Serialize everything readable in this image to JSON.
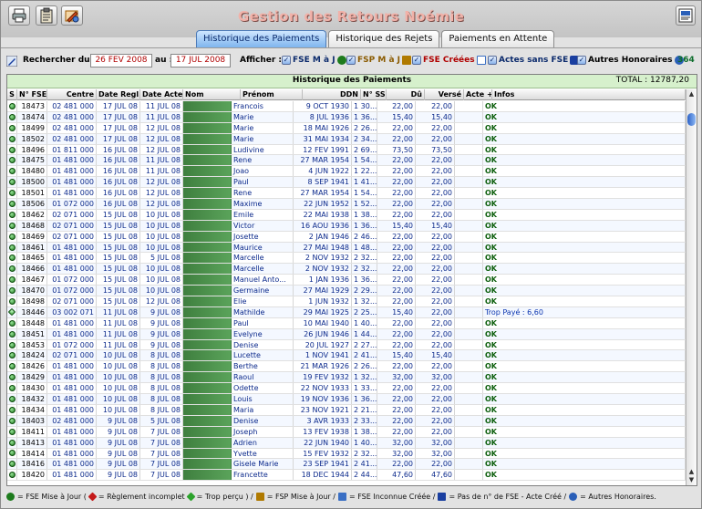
{
  "window": {
    "title": "Gestion des Retours Noémie"
  },
  "toolbar": {
    "print_icon": "printer-icon",
    "clipboard_icon": "clipboard-icon",
    "tools_icon": "pencil-gear-icon",
    "help_icon": "help-icon"
  },
  "tabs": [
    {
      "label": "Historique des Paiements",
      "active": true
    },
    {
      "label": "Historique des Rejets",
      "active": false
    },
    {
      "label": "Paiements en Attente",
      "active": false
    }
  ],
  "filters": {
    "search_label": "Rechercher du :",
    "date_from": "26 FEV 2008",
    "to_label": "au :",
    "date_to": "17 JUL 2008",
    "show_label": "Afficher :",
    "options": [
      {
        "label": "FSE M à J",
        "checked": true,
        "color": "#0b2a6c"
      },
      {
        "label": "FSP M à J",
        "checked": true,
        "color": "#8a5a00"
      },
      {
        "label": "FSE Créées",
        "checked": true,
        "color": "#b00000"
      },
      {
        "label": "Actes sans FSE",
        "checked": true,
        "color": "#0b2a6c"
      },
      {
        "label": "Autres Honoraires",
        "checked": true,
        "color": "#000000"
      }
    ],
    "count": "364"
  },
  "panel": {
    "title": "Historique des Paiements",
    "total": "TOTAL : 12787,20"
  },
  "columns": [
    "S",
    "N° FSE",
    "Centre",
    "Date Regl.",
    "Date Acte",
    "Nom",
    "Prénom",
    "DDN",
    "N° SS",
    "Dû",
    "Versé",
    "Acte +",
    "Infos"
  ],
  "rows": [
    {
      "s": "ok",
      "fse": "18473",
      "centre": "02 481 000",
      "regl": "17 JUL 08",
      "acte": "11 JUL 08",
      "nom": "G",
      "prenom": "Francois",
      "ddn": "9 OCT 1930",
      "ss": "1 30...",
      "du": "22,00",
      "verse": "22,00",
      "plus": "",
      "info": "OK"
    },
    {
      "s": "ok",
      "fse": "18474",
      "centre": "02 481 000",
      "regl": "17 JUL 08",
      "acte": "11 JUL 08",
      "nom": "G",
      "prenom": "Marie",
      "ddn": "8 JUL 1936",
      "ss": "1 36...",
      "du": "15,40",
      "verse": "15,40",
      "plus": "",
      "info": "OK"
    },
    {
      "s": "ok",
      "fse": "18499",
      "centre": "02 481 000",
      "regl": "17 JUL 08",
      "acte": "12 JUL 08",
      "nom": "B",
      "prenom": "Marie",
      "ddn": "18 MAI 1926",
      "ss": "2 26...",
      "du": "22,00",
      "verse": "22,00",
      "plus": "",
      "info": "OK"
    },
    {
      "s": "ok",
      "fse": "18502",
      "centre": "02 481 000",
      "regl": "17 JUL 08",
      "acte": "12 JUL 08",
      "nom": "P",
      "prenom": "Marie",
      "ddn": "31 MAI 1934",
      "ss": "2 34...",
      "du": "22,00",
      "verse": "22,00",
      "plus": "",
      "info": "OK"
    },
    {
      "s": "ok",
      "fse": "18496",
      "centre": "01 811 000",
      "regl": "16 JUL 08",
      "acte": "12 JUL 08",
      "nom": "C",
      "prenom": "Ludivine",
      "ddn": "12 FEV 1991",
      "ss": "2 69...",
      "du": "73,50",
      "verse": "73,50",
      "plus": "",
      "info": "OK"
    },
    {
      "s": "ok",
      "fse": "18475",
      "centre": "01 481 000",
      "regl": "16 JUL 08",
      "acte": "11 JUL 08",
      "nom": "A",
      "prenom": "Rene",
      "ddn": "27 MAR 1954",
      "ss": "1 54...",
      "du": "22,00",
      "verse": "22,00",
      "plus": "",
      "info": "OK"
    },
    {
      "s": "ok",
      "fse": "18480",
      "centre": "01 481 000",
      "regl": "16 JUL 08",
      "acte": "11 JUL 08",
      "nom": "D",
      "prenom": "Joao",
      "ddn": "4 JUN 1922",
      "ss": "1 22...",
      "du": "22,00",
      "verse": "22,00",
      "plus": "",
      "info": "OK"
    },
    {
      "s": "ok",
      "fse": "18500",
      "centre": "01 481 000",
      "regl": "16 JUL 08",
      "acte": "12 JUL 08",
      "nom": "M",
      "prenom": "Paul",
      "ddn": "8 SEP 1941",
      "ss": "1 41...",
      "du": "22,00",
      "verse": "22,00",
      "plus": "",
      "info": "OK"
    },
    {
      "s": "ok",
      "fse": "18501",
      "centre": "01 481 000",
      "regl": "16 JUL 08",
      "acte": "12 JUL 08",
      "nom": "A",
      "prenom": "Rene",
      "ddn": "27 MAR 1954",
      "ss": "1 54...",
      "du": "22,00",
      "verse": "22,00",
      "plus": "",
      "info": "OK"
    },
    {
      "s": "ok",
      "fse": "18506",
      "centre": "01 072 000",
      "regl": "16 JUL 08",
      "acte": "12 JUL 08",
      "nom": "D",
      "prenom": "Maxime",
      "ddn": "22 JUN 1952",
      "ss": "1 52...",
      "du": "22,00",
      "verse": "22,00",
      "plus": "",
      "info": "OK"
    },
    {
      "s": "ok",
      "fse": "18462",
      "centre": "02 071 000",
      "regl": "15 JUL 08",
      "acte": "10 JUL 08",
      "nom": "B",
      "prenom": "Emile",
      "ddn": "22 MAI 1938",
      "ss": "1 38...",
      "du": "22,00",
      "verse": "22,00",
      "plus": "",
      "info": "OK"
    },
    {
      "s": "ok",
      "fse": "18468",
      "centre": "02 071 000",
      "regl": "15 JUL 08",
      "acte": "10 JUL 08",
      "nom": "M",
      "prenom": "Victor",
      "ddn": "16 AOU 1936",
      "ss": "1 36...",
      "du": "15,40",
      "verse": "15,40",
      "plus": "",
      "info": "OK"
    },
    {
      "s": "ok",
      "fse": "18469",
      "centre": "02 071 000",
      "regl": "15 JUL 08",
      "acte": "10 JUL 08",
      "nom": "D",
      "prenom": "Josette",
      "ddn": "2 JAN 1946",
      "ss": "2 46...",
      "du": "22,00",
      "verse": "22,00",
      "plus": "",
      "info": "OK"
    },
    {
      "s": "ok",
      "fse": "18461",
      "centre": "01 481 000",
      "regl": "15 JUL 08",
      "acte": "10 JUL 08",
      "nom": "M",
      "prenom": "Maurice",
      "ddn": "27 MAI 1948",
      "ss": "1 48...",
      "du": "22,00",
      "verse": "22,00",
      "plus": "",
      "info": "OK"
    },
    {
      "s": "ok",
      "fse": "18465",
      "centre": "01 481 000",
      "regl": "15 JUL 08",
      "acte": "5 JUL 08",
      "nom": "A",
      "prenom": "Marcelle",
      "ddn": "2 NOV 1932",
      "ss": "2 32...",
      "du": "22,00",
      "verse": "22,00",
      "plus": "",
      "info": "OK"
    },
    {
      "s": "ok",
      "fse": "18466",
      "centre": "01 481 000",
      "regl": "15 JUL 08",
      "acte": "10 JUL 08",
      "nom": "A",
      "prenom": "Marcelle",
      "ddn": "2 NOV 1932",
      "ss": "2 32...",
      "du": "22,00",
      "verse": "22,00",
      "plus": "",
      "info": "OK"
    },
    {
      "s": "ok",
      "fse": "18467",
      "centre": "01 072 000",
      "regl": "15 JUL 08",
      "acte": "10 JUL 08",
      "nom": "D",
      "prenom": "Manuel Anto...",
      "ddn": "1 JAN 1936",
      "ss": "1 36...",
      "du": "22,00",
      "verse": "22,00",
      "plus": "",
      "info": "OK"
    },
    {
      "s": "ok",
      "fse": "18470",
      "centre": "01 072 000",
      "regl": "15 JUL 08",
      "acte": "10 JUL 08",
      "nom": "D",
      "prenom": "Germaine",
      "ddn": "27 MAI 1929",
      "ss": "2 29...",
      "du": "22,00",
      "verse": "22,00",
      "plus": "",
      "info": "OK"
    },
    {
      "s": "ok",
      "fse": "18498",
      "centre": "02 071 000",
      "regl": "15 JUL 08",
      "acte": "12 JUL 08",
      "nom": "JO",
      "prenom": "Elie",
      "ddn": "1 JUN 1932",
      "ss": "1 32...",
      "du": "22,00",
      "verse": "22,00",
      "plus": "",
      "info": "OK"
    },
    {
      "s": "trop",
      "fse": "18446",
      "centre": "03 002 071",
      "regl": "11 JUL 08",
      "acte": "9 JUL 08",
      "nom": "C",
      "prenom": "Mathilde",
      "ddn": "29 MAI 1925",
      "ss": "2 25...",
      "du": "15,40",
      "verse": "22,00",
      "plus": "",
      "info": "Trop Payé : 6,60"
    },
    {
      "s": "ok",
      "fse": "18448",
      "centre": "01 481 000",
      "regl": "11 JUL 08",
      "acte": "9 JUL 08",
      "nom": "P",
      "prenom": "Paul",
      "ddn": "10 MAI 1940",
      "ss": "1 40...",
      "du": "22,00",
      "verse": "22,00",
      "plus": "",
      "info": "OK"
    },
    {
      "s": "ok",
      "fse": "18451",
      "centre": "01 481 000",
      "regl": "11 JUL 08",
      "acte": "9 JUL 08",
      "nom": "V",
      "prenom": "Evelyne",
      "ddn": "26 JUN 1946",
      "ss": "1 44...",
      "du": "22,00",
      "verse": "22,00",
      "plus": "",
      "info": "OK"
    },
    {
      "s": "ok",
      "fse": "18453",
      "centre": "01 072 000",
      "regl": "11 JUL 08",
      "acte": "9 JUL 08",
      "nom": "M",
      "prenom": "Denise",
      "ddn": "20 JUL 1927",
      "ss": "2 27...",
      "du": "22,00",
      "verse": "22,00",
      "plus": "",
      "info": "OK"
    },
    {
      "s": "ok",
      "fse": "18424",
      "centre": "02 071 000",
      "regl": "10 JUL 08",
      "acte": "8 JUL 08",
      "nom": "M",
      "prenom": "Lucette",
      "ddn": "1 NOV 1941",
      "ss": "2 41...",
      "du": "15,40",
      "verse": "15,40",
      "plus": "",
      "info": "OK"
    },
    {
      "s": "ok",
      "fse": "18426",
      "centre": "01 481 000",
      "regl": "10 JUL 08",
      "acte": "8 JUL 08",
      "nom": "B",
      "prenom": "Berthe",
      "ddn": "21 MAR 1926",
      "ss": "2 26...",
      "du": "22,00",
      "verse": "22,00",
      "plus": "",
      "info": "OK"
    },
    {
      "s": "ok",
      "fse": "18429",
      "centre": "01 481 000",
      "regl": "10 JUL 08",
      "acte": "8 JUL 08",
      "nom": "B",
      "prenom": "Raoul",
      "ddn": "19 FEV 1932",
      "ss": "1 32...",
      "du": "32,00",
      "verse": "32,00",
      "plus": "",
      "info": "OK"
    },
    {
      "s": "ok",
      "fse": "18430",
      "centre": "01 481 000",
      "regl": "10 JUL 08",
      "acte": "8 JUL 08",
      "nom": "D",
      "prenom": "Odette",
      "ddn": "22 NOV 1933",
      "ss": "1 33...",
      "du": "22,00",
      "verse": "22,00",
      "plus": "",
      "info": "OK"
    },
    {
      "s": "ok",
      "fse": "18432",
      "centre": "01 481 000",
      "regl": "10 JUL 08",
      "acte": "8 JUL 08",
      "nom": "B",
      "prenom": "Louis",
      "ddn": "19 NOV 1936",
      "ss": "1 36...",
      "du": "22,00",
      "verse": "22,00",
      "plus": "",
      "info": "OK"
    },
    {
      "s": "ok",
      "fse": "18434",
      "centre": "01 481 000",
      "regl": "10 JUL 08",
      "acte": "8 JUL 08",
      "nom": "R",
      "prenom": "Maria",
      "ddn": "23 NOV 1921",
      "ss": "2 21...",
      "du": "22,00",
      "verse": "22,00",
      "plus": "",
      "info": "OK"
    },
    {
      "s": "ok",
      "fse": "18403",
      "centre": "02 481 000",
      "regl": "9 JUL 08",
      "acte": "5 JUL 08",
      "nom": "C",
      "prenom": "Denise",
      "ddn": "3 AVR 1933",
      "ss": "2 33...",
      "du": "22,00",
      "verse": "22,00",
      "plus": "",
      "info": "OK"
    },
    {
      "s": "ok",
      "fse": "18411",
      "centre": "01 481 000",
      "regl": "9 JUL 08",
      "acte": "7 JUL 08",
      "nom": "C",
      "prenom": "Joseph",
      "ddn": "13 FEV 1938",
      "ss": "1 38...",
      "du": "22,00",
      "verse": "22,00",
      "plus": "",
      "info": "OK"
    },
    {
      "s": "ok",
      "fse": "18413",
      "centre": "01 481 000",
      "regl": "9 JUL 08",
      "acte": "7 JUL 08",
      "nom": "L",
      "prenom": "Adrien",
      "ddn": "22 JUN 1940",
      "ss": "1 40...",
      "du": "32,00",
      "verse": "32,00",
      "plus": "",
      "info": "OK"
    },
    {
      "s": "ok",
      "fse": "18414",
      "centre": "01 481 000",
      "regl": "9 JUL 08",
      "acte": "7 JUL 08",
      "nom": "C",
      "prenom": "Yvette",
      "ddn": "15 FEV 1932",
      "ss": "2 32...",
      "du": "32,00",
      "verse": "32,00",
      "plus": "",
      "info": "OK"
    },
    {
      "s": "ok",
      "fse": "18416",
      "centre": "01 481 000",
      "regl": "9 JUL 08",
      "acte": "7 JUL 08",
      "nom": "G",
      "prenom": "Gisele Marie",
      "ddn": "23 SEP 1941",
      "ss": "2 41...",
      "du": "22,00",
      "verse": "22,00",
      "plus": "",
      "info": "OK"
    },
    {
      "s": "ok",
      "fse": "18420",
      "centre": "01 481 000",
      "regl": "9 JUL 08",
      "acte": "7 JUL 08",
      "nom": "B",
      "prenom": "Francette",
      "ddn": "18 DEC 1944",
      "ss": "2 44...",
      "du": "47,60",
      "verse": "47,60",
      "plus": "",
      "info": "OK"
    }
  ],
  "legend": [
    {
      "icon": "green-circle-icon",
      "color": "#1d7b1d",
      "text": "= FSE Mise à Jour ("
    },
    {
      "icon": "red-diamond-icon",
      "color": "#c41a1a",
      "text": "= Règlement incomplet"
    },
    {
      "icon": "green-diamond-icon",
      "color": "#2ca32c",
      "text": "= Trop perçu ) /"
    },
    {
      "icon": "fsp-icon",
      "color": "#b07a00",
      "text": "= FSP Mise à Jour /"
    },
    {
      "icon": "document-icon",
      "color": "#3a6fc4",
      "text": "= FSE Inconnue Créée /"
    },
    {
      "icon": "actes-icon",
      "color": "#1a3fa0",
      "text": "= Pas de n° de FSE - Acte Créé /"
    },
    {
      "icon": "honoraires-icon",
      "color": "#2a5fb8",
      "text": "= Autres Honoraires."
    }
  ]
}
